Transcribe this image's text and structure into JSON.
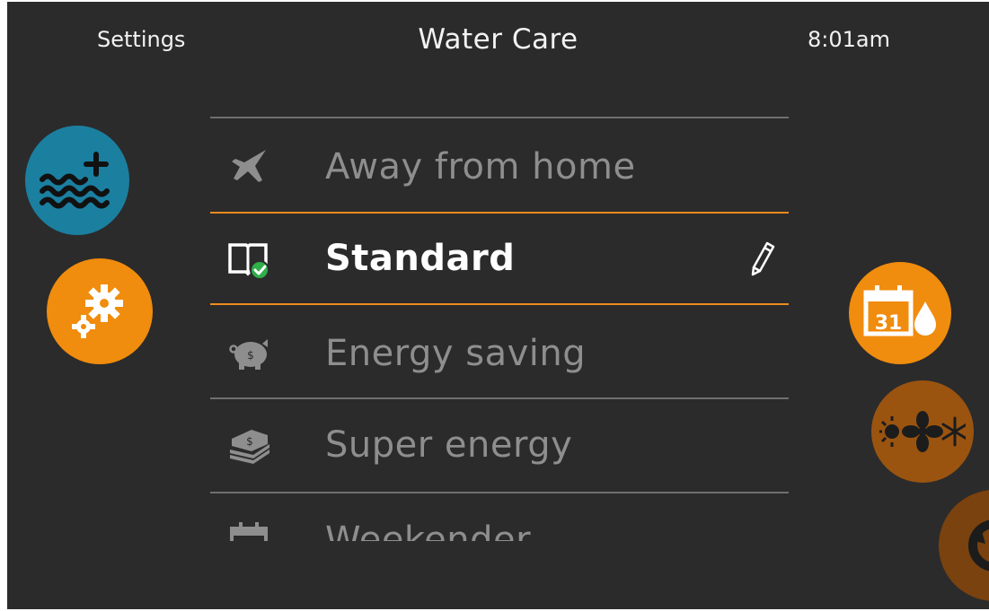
{
  "header": {
    "back_label": "Settings",
    "title": "Water Care",
    "time": "8:01am"
  },
  "side_buttons": {
    "left": [
      {
        "name": "water-add-icon",
        "color": "#1b7fa0"
      },
      {
        "name": "gears-icon",
        "color": "#f08c0e"
      }
    ],
    "right": [
      {
        "name": "calendar-water-icon",
        "color": "#f08c0e"
      },
      {
        "name": "heat-fan-snow-icon",
        "color": "#9a5410"
      },
      {
        "name": "cycle-icon",
        "color": "#7a420e"
      }
    ]
  },
  "water_care_modes": [
    {
      "label": "Away from home",
      "icon": "airplane-icon",
      "selected": false
    },
    {
      "label": "Standard",
      "icon": "book-check-icon",
      "selected": true
    },
    {
      "label": "Energy saving",
      "icon": "piggy-bank-icon",
      "selected": false
    },
    {
      "label": "Super energy",
      "icon": "money-stack-icon",
      "selected": false
    },
    {
      "label": "Weekender",
      "icon": "calendar-icon",
      "selected": false
    }
  ],
  "colors": {
    "background": "#2b2b2b",
    "accent": "#ee8a1f",
    "text_active": "#ffffff",
    "text_inactive": "#8e8e8e",
    "check_green": "#2fae4a"
  }
}
